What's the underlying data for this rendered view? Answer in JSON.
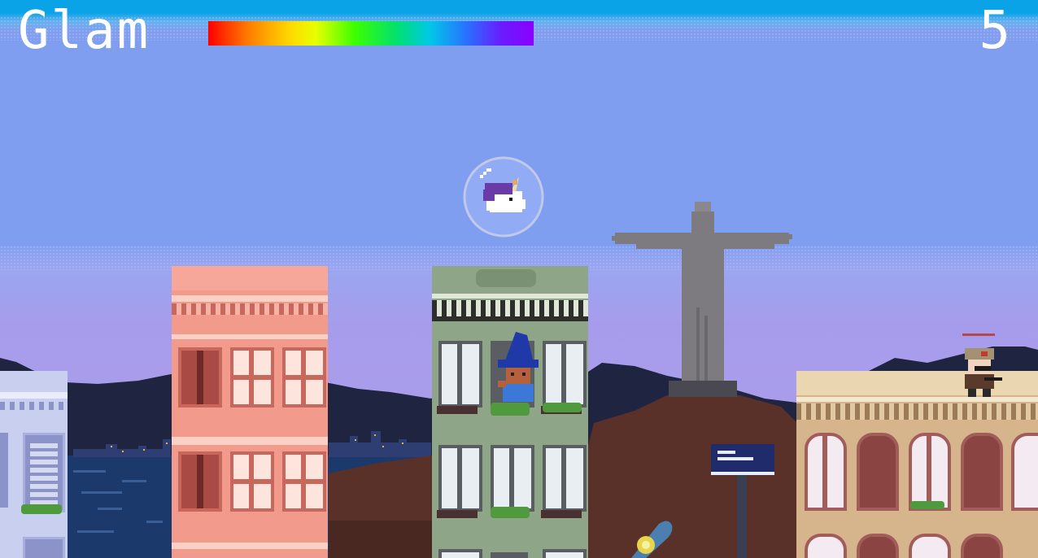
{
  "hud": {
    "meter_label": "Glam",
    "glam_level": 1.0,
    "score": "5"
  },
  "colors": {
    "sky": "#7f9ef0",
    "sky_top_band": "#0aa3e8",
    "sky_horizon": "#ad9fe8",
    "hills": "#1f2440",
    "bay_water": "#1b3a6b",
    "ground": "#5a3128",
    "pink_building": "#f29a8c",
    "green_building": "#8ea587",
    "lavender_building": "#c9cfee",
    "tan_building": "#d6b48c",
    "statue": "#7d7b80",
    "street_sign": "#1f2b6b"
  },
  "entities": {
    "player": "unicorn-in-bubble",
    "window_character": "girl-with-blue-hat",
    "rooftop_character": "soldier-with-cap",
    "landmark": "christ-the-redeemer-statue",
    "signpost": "street-sign",
    "pickup": "blue-skateboard"
  }
}
